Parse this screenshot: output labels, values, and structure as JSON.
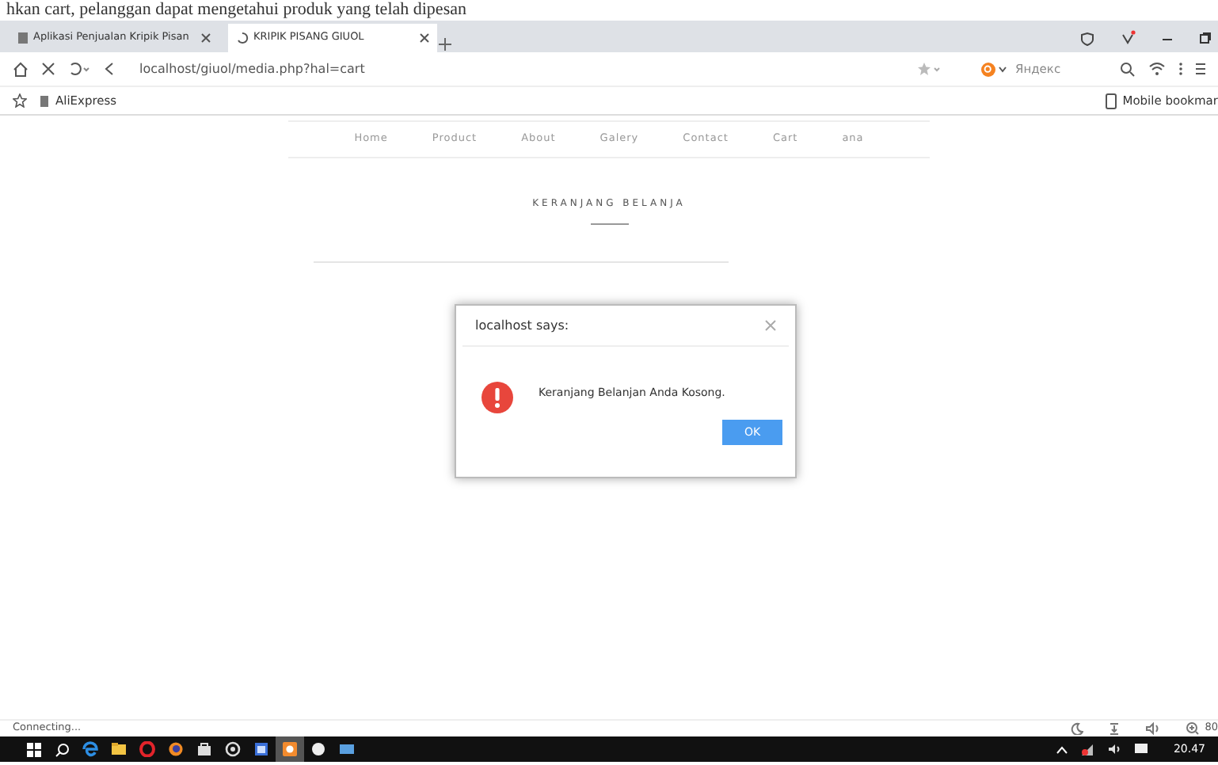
{
  "caption": "hkan cart, pelanggan dapat mengetahui produk yang telah dipesan",
  "browser": {
    "tabs": [
      {
        "title": "Aplikasi Penjualan Kripik Pisan",
        "selected": false,
        "loading": false
      },
      {
        "title": "KRIPIK PISANG GIUOL",
        "selected": true,
        "loading": true
      }
    ],
    "url": "localhost/giuol/media.php?hal=cart",
    "search_engine": "Яндекс",
    "bookmarks": [
      "AliExpress"
    ],
    "mobile_bookmarks": "Mobile bookmar"
  },
  "site": {
    "nav": [
      "Home",
      "Product",
      "About",
      "Galery",
      "Contact",
      "Cart",
      "ana"
    ],
    "heading": "KERANJANG BELANJA"
  },
  "dialog": {
    "title": "localhost says:",
    "message": "Keranjang Belanjan Anda Kosong.",
    "button": "OK"
  },
  "status_bar": {
    "text": "Connecting...",
    "zoom": "80"
  },
  "taskbar": {
    "apps": [
      {
        "kind": "edge",
        "selected": false
      },
      {
        "kind": "folder",
        "selected": false
      },
      {
        "kind": "opera",
        "selected": false
      },
      {
        "kind": "firefox",
        "selected": false
      },
      {
        "kind": "store",
        "selected": false
      },
      {
        "kind": "media",
        "selected": false
      },
      {
        "kind": "window",
        "selected": false
      },
      {
        "kind": "paint",
        "selected": true
      },
      {
        "kind": "ball",
        "selected": false
      },
      {
        "kind": "mail",
        "selected": false
      }
    ],
    "time": "20.47"
  }
}
